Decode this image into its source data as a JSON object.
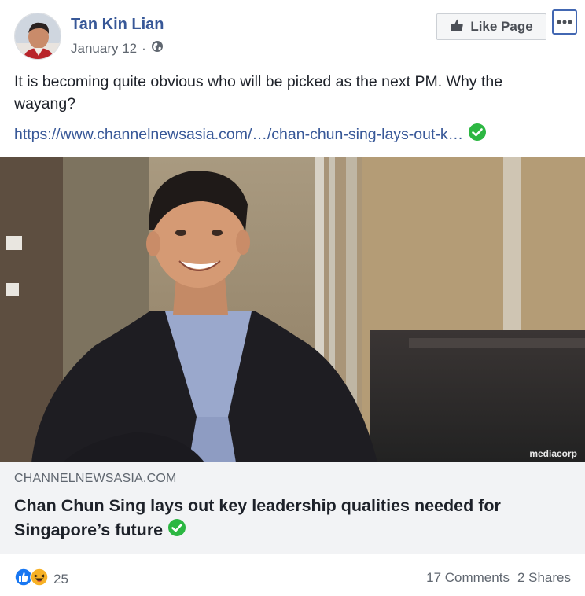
{
  "post": {
    "author": "Tan Kin Lian",
    "date": "January 12",
    "separator": "·",
    "privacy_icon": "globe-icon",
    "text": "It is becoming quite obvious who will be picked as the next PM. Why the wayang?",
    "link_text": "https://www.channelnewsasia.com/…/chan-chun-sing-lays-out-k…"
  },
  "header": {
    "like_page_label": "Like Page",
    "more_icon": "more-dots-icon"
  },
  "preview": {
    "watermark": "mediacorp",
    "domain": "CHANNELNEWSASIA.COM",
    "headline": "Chan Chun Sing lays out key leadership qualities needed for Singapore’s future"
  },
  "footer": {
    "reaction_count": "25",
    "comments": "17 Comments",
    "shares": "2 Shares"
  },
  "colors": {
    "link": "#385898",
    "verified_green": "#2cb742",
    "like_blue": "#1877f2",
    "haha_yellow": "#f7b125"
  }
}
